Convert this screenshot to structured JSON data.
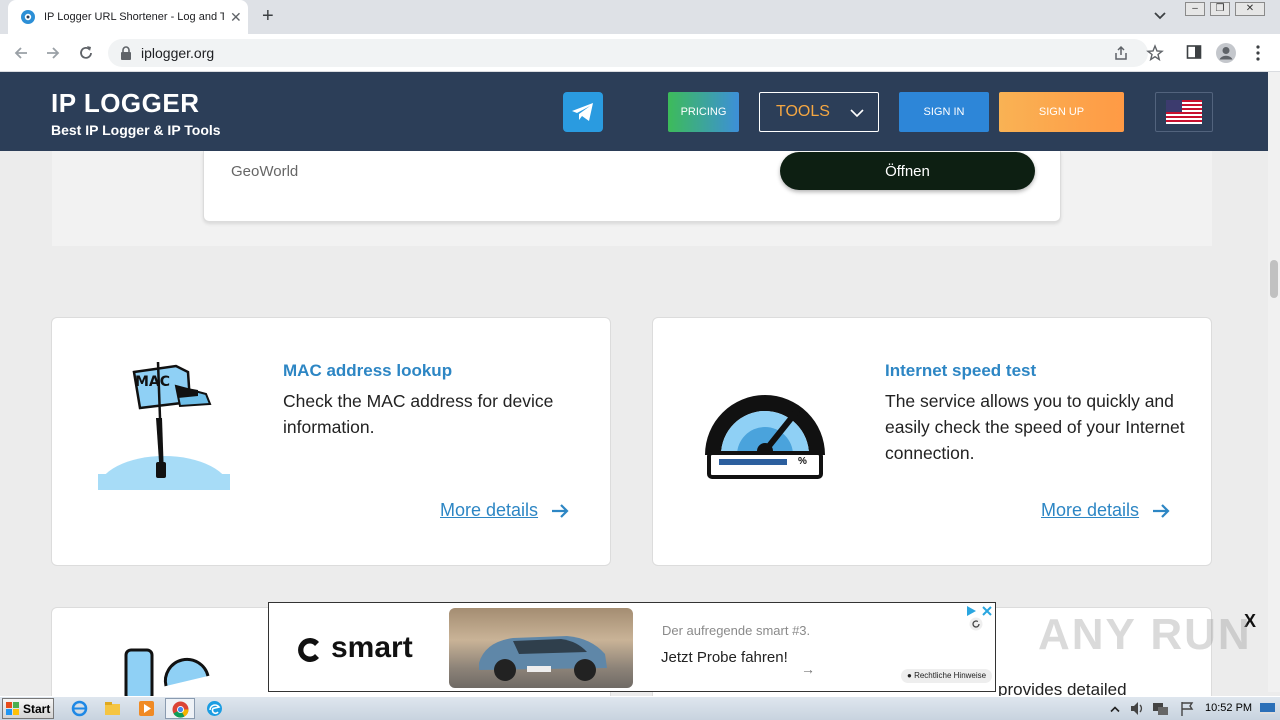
{
  "browser": {
    "tab_title": "IP Logger URL Shortener - Log and T",
    "tab_close": "✕",
    "new_tab": "+",
    "url": "iplogger.org"
  },
  "header": {
    "logo": "IP LOGGER",
    "tagline": "Best IP Logger & IP Tools",
    "pricing": "PRICING",
    "tools": "TOOLS",
    "sign_in": "SIGN IN",
    "sign_up": "SIGN UP"
  },
  "top_ad": {
    "advertiser": "GeoWorld",
    "button": "Öffnen"
  },
  "cards": [
    {
      "title": "MAC address lookup",
      "description": "Check the MAC address for device information.",
      "image_label": "MAC",
      "link": "More details"
    },
    {
      "title": "Internet speed test",
      "description": "The service allows you to quickly and easily check the speed of your Internet connection.",
      "gauge_label": "%",
      "link": "More details"
    }
  ],
  "partial_text": "provides detailed",
  "ad_banner": {
    "brand": "smart",
    "subtitle": "Der aufregende smart #3.",
    "cta": "Jetzt Probe fahren!",
    "cta_arrow": "→",
    "hint": "Rechtliche Hinweise",
    "close": "X"
  },
  "watermark": "ANY RUN",
  "taskbar": {
    "start": "Start",
    "clock": "10:52 PM"
  },
  "colors": {
    "header_bg": "#2c3e58",
    "link_blue": "#2d86c4",
    "signup_orange": "#ff9a45",
    "signin_blue": "#2d86d8"
  }
}
